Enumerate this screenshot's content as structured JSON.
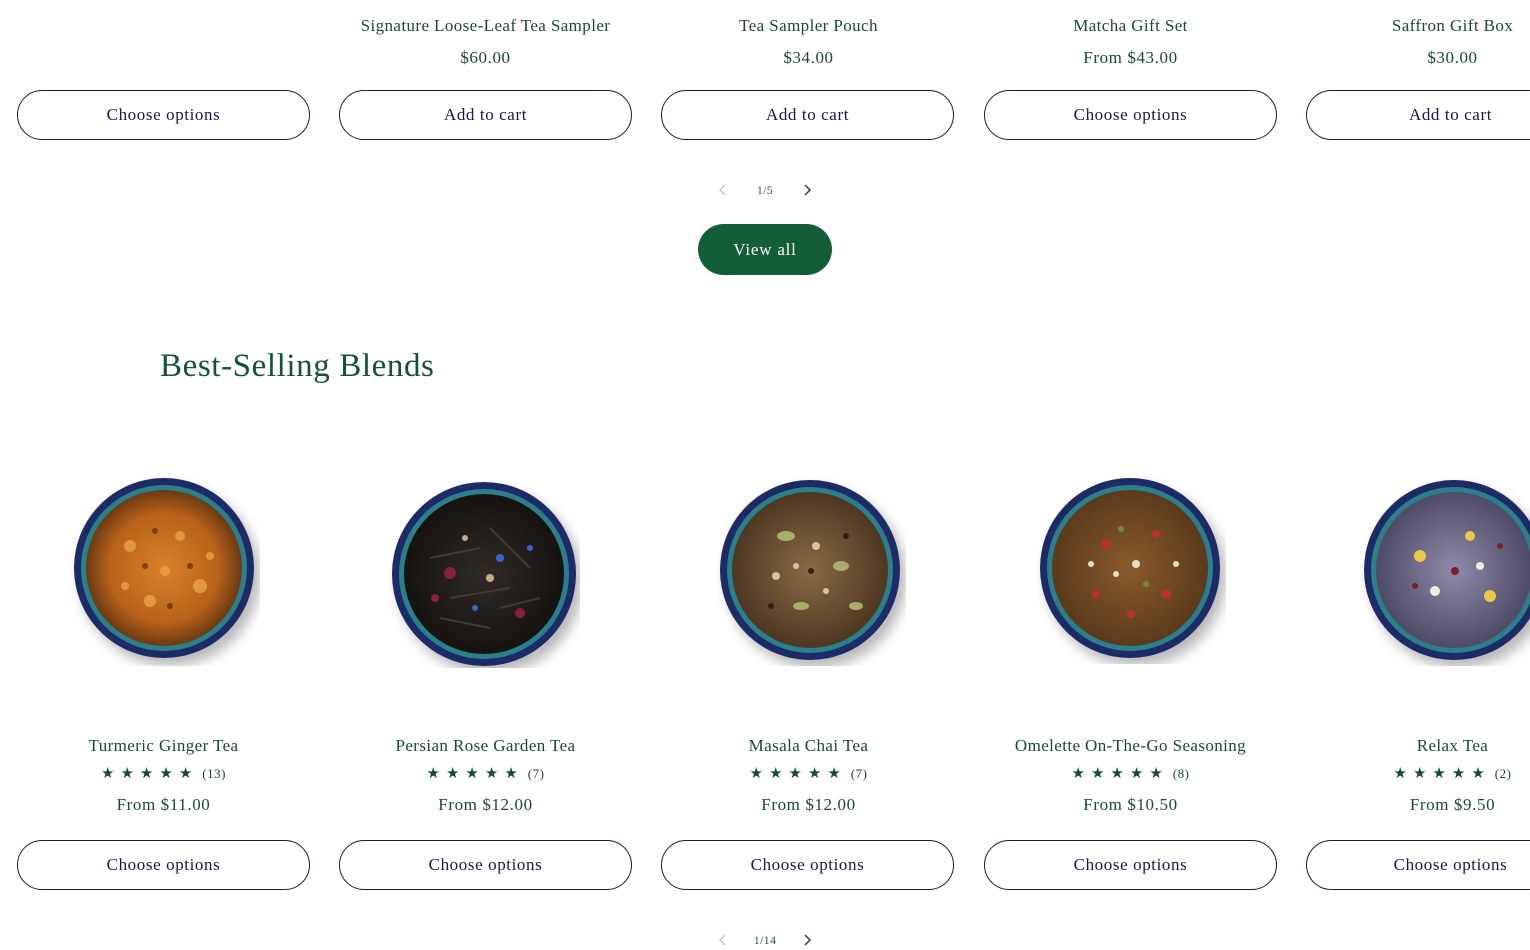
{
  "top_row": [
    {
      "title": "",
      "price": "",
      "button": "Choose options"
    },
    {
      "title": "Signature Loose-Leaf Tea Sampler",
      "price": "$60.00",
      "button": "Add to cart"
    },
    {
      "title": "Tea Sampler Pouch",
      "price": "$34.00",
      "button": "Add to cart"
    },
    {
      "title": "Matcha Gift Set",
      "price": "From $43.00",
      "button": "Choose options"
    },
    {
      "title": "Saffron Gift Box",
      "price": "$30.00",
      "button": "Add to cart"
    }
  ],
  "top_pager": {
    "count": "1/5"
  },
  "view_all": "View all",
  "best_selling": {
    "heading": "Best-Selling Blends",
    "products": [
      {
        "title": "Turmeric Ginger Tea",
        "stars": "★★★★★",
        "rating_count": "(13)",
        "price": "From $11.00",
        "button": "Choose options"
      },
      {
        "title": "Persian Rose Garden Tea",
        "stars": "★★★★★",
        "rating_count": "(7)",
        "price": "From $12.00",
        "button": "Choose options"
      },
      {
        "title": "Masala Chai Tea",
        "stars": "★★★★★",
        "rating_count": "(7)",
        "price": "From $12.00",
        "button": "Choose options"
      },
      {
        "title": "Omelette On-The-Go Seasoning",
        "stars": "★★★★★",
        "rating_count": "(8)",
        "price": "From $10.50",
        "button": "Choose options"
      },
      {
        "title": "Relax Tea",
        "stars": "★★★★★",
        "rating_count": "(2)",
        "price": "From $9.50",
        "button": "Choose options"
      }
    ],
    "pager": {
      "count": "1/14"
    }
  },
  "icons": {
    "prev": "chevron-left-icon",
    "next": "chevron-right-icon",
    "star": "star-icon"
  },
  "colors": {
    "brand_green": "#135e36",
    "text_green": "#174a33",
    "button_navy": "#121a4d"
  }
}
